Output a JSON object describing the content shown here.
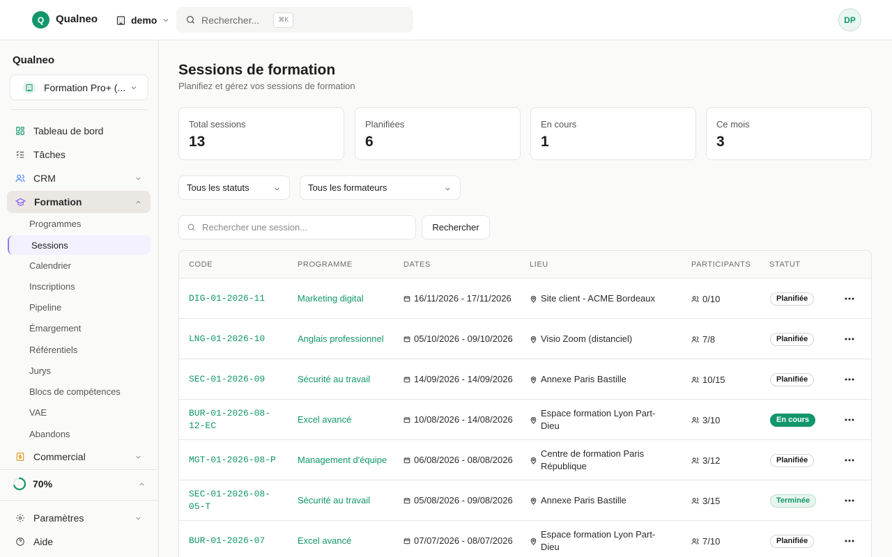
{
  "app": {
    "logo_letter": "Q",
    "name": "Qualneo",
    "workspace": "demo",
    "search_placeholder": "Rechercher...",
    "search_shortcut": "⌘K",
    "user_initials": "DP"
  },
  "sidebar": {
    "title": "Qualneo",
    "org": "Formation Pro+ (...",
    "nav": [
      {
        "label": "Tableau de bord",
        "icon": "dashboard-icon"
      },
      {
        "label": "Tâches",
        "icon": "tasks-icon"
      },
      {
        "label": "CRM",
        "icon": "users-icon"
      },
      {
        "label": "Formation",
        "icon": "graduation-cap-icon"
      }
    ],
    "formation_sub": [
      "Programmes",
      "Sessions",
      "Calendrier",
      "Inscriptions",
      "Pipeline",
      "Émargement",
      "Référentiels",
      "Jurys",
      "Blocs de compétences",
      "VAE",
      "Abandons"
    ],
    "commercial": "Commercial",
    "progress": "70%",
    "progress_value": 0.7,
    "settings": "Paramètres",
    "help": "Aide"
  },
  "main": {
    "title": "Sessions de formation",
    "subtitle": "Planifiez et gérez vos sessions de formation",
    "stats": [
      {
        "label": "Total sessions",
        "value": "13"
      },
      {
        "label": "Planifiées",
        "value": "6"
      },
      {
        "label": "En cours",
        "value": "1"
      },
      {
        "label": "Ce mois",
        "value": "3"
      }
    ],
    "filter_status": "Tous les statuts",
    "filter_trainer": "Tous les formateurs",
    "search_placeholder": "Rechercher une session...",
    "search_button": "Rechercher",
    "columns": [
      "CODE",
      "PROGRAMME",
      "DATES",
      "LIEU",
      "PARTICIPANTS",
      "STATUT"
    ],
    "rows": [
      {
        "code": "DIG-01-2026-11",
        "programme": "Marketing digital",
        "dates": "16/11/2026 - 17/11/2026",
        "lieu": "Site client - ACME Bordeaux",
        "participants": "0/10",
        "status": "Planifiée",
        "kind": "planned"
      },
      {
        "code": "LNG-01-2026-10",
        "programme": "Anglais professionnel",
        "dates": "05/10/2026 - 09/10/2026",
        "lieu": "Visio Zoom (distanciel)",
        "participants": "7/8",
        "status": "Planifiée",
        "kind": "planned"
      },
      {
        "code": "SEC-01-2026-09",
        "programme": "Sécurité au travail",
        "dates": "14/09/2026 - 14/09/2026",
        "lieu": "Annexe Paris Bastille",
        "participants": "10/15",
        "status": "Planifiée",
        "kind": "planned"
      },
      {
        "code": "BUR-01-2026-08-12-EC",
        "programme": "Excel avancé",
        "dates": "10/08/2026 - 14/08/2026",
        "lieu": "Espace formation Lyon Part-Dieu",
        "participants": "3/10",
        "status": "En cours",
        "kind": "ongoing"
      },
      {
        "code": "MGT-01-2026-08-P",
        "programme": "Management d'équipe",
        "dates": "06/08/2026 - 08/08/2026",
        "lieu": "Centre de formation Paris République",
        "participants": "3/12",
        "status": "Planifiée",
        "kind": "planned"
      },
      {
        "code": "SEC-01-2026-08-05-T",
        "programme": "Sécurité au travail",
        "dates": "05/08/2026 - 09/08/2026",
        "lieu": "Annexe Paris Bastille",
        "participants": "3/15",
        "status": "Terminée",
        "kind": "done"
      },
      {
        "code": "BUR-01-2026-07",
        "programme": "Excel avancé",
        "dates": "07/07/2026 - 08/07/2026",
        "lieu": "Espace formation Lyon Part-Dieu",
        "participants": "7/10",
        "status": "Planifiée",
        "kind": "planned"
      }
    ]
  },
  "colors": {
    "accent": "#12966b",
    "active_nav": "#ebe8e3",
    "sub_active": "#8b7cf0",
    "commercial_icon": "#e29a1b"
  }
}
